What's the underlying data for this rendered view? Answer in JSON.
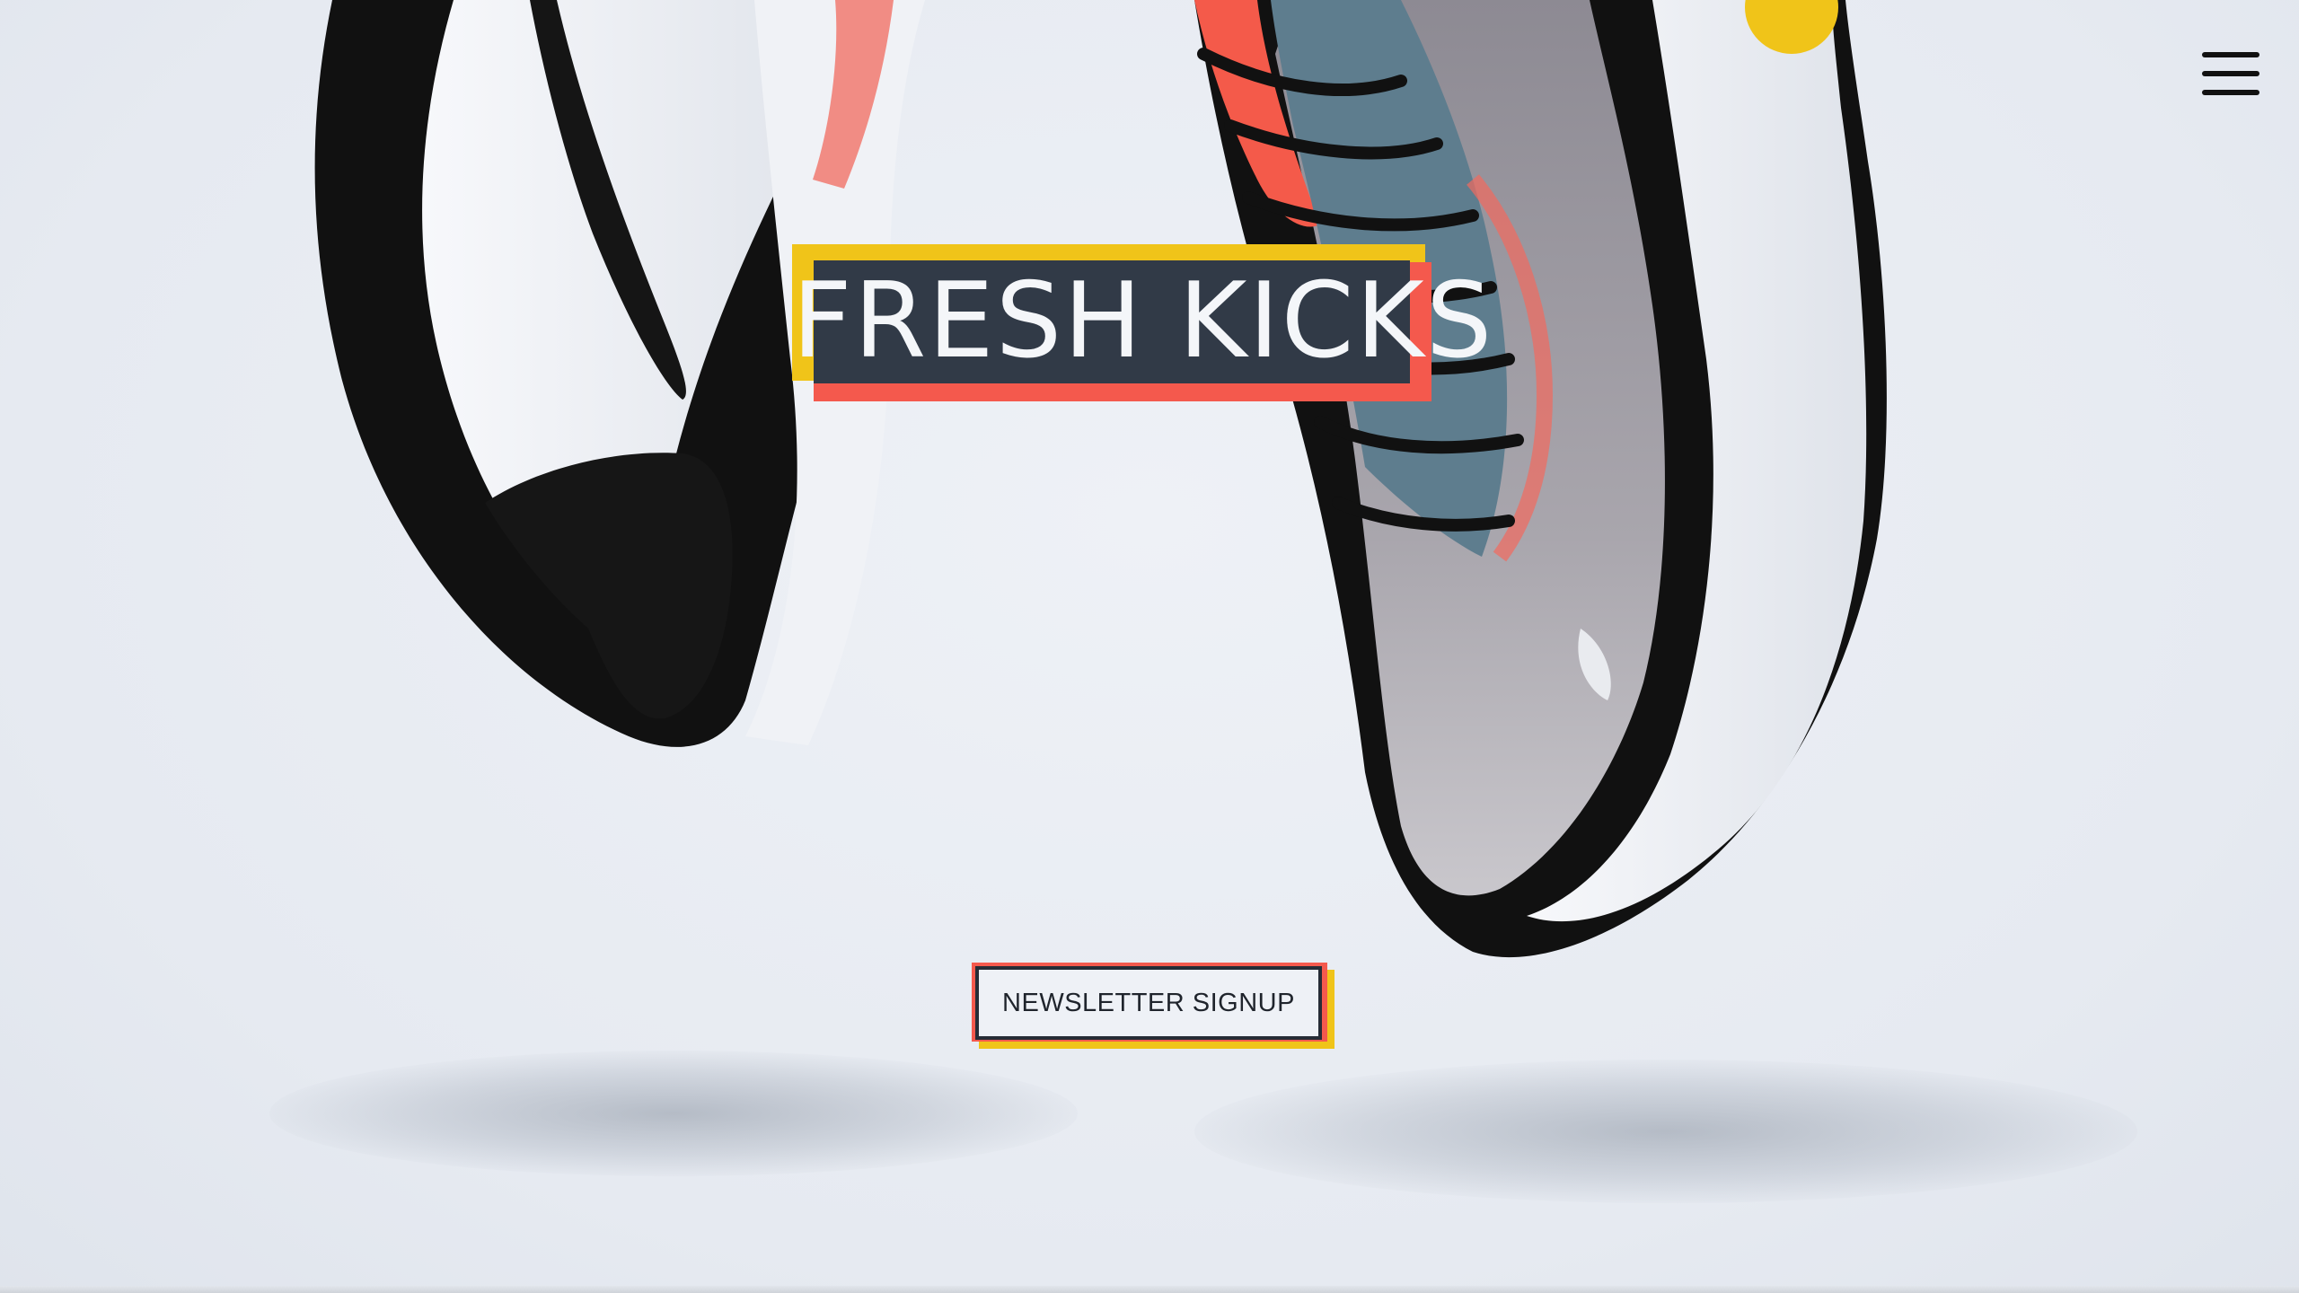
{
  "hero": {
    "title": "FRESH KICKS"
  },
  "cta": {
    "label": "NEWSLETTER SIGNUP"
  },
  "nav": {
    "menu_icon": "hamburger-menu-icon"
  },
  "colors": {
    "accent_yellow": "#f0c419",
    "accent_red": "#f4594d",
    "dark_slate": "#313a47",
    "background": "#e9edf4"
  }
}
